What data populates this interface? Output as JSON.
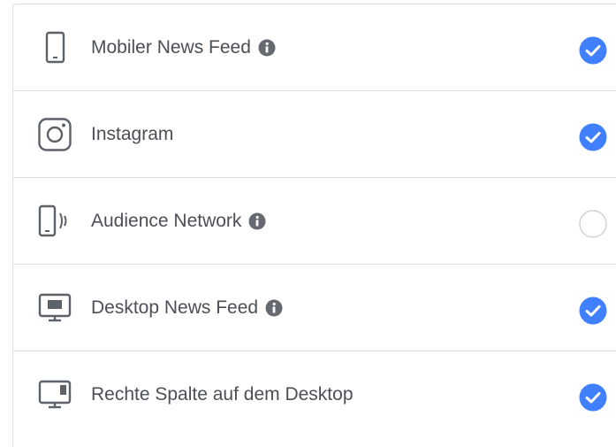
{
  "colors": {
    "accent": "#4080ff",
    "text": "#4b4f56",
    "icon": "#5d6168",
    "border": "#dddfe2"
  },
  "placements": [
    {
      "label": "Mobiler News Feed",
      "icon": "mobile-phone-icon",
      "has_info": true,
      "checked": true
    },
    {
      "label": "Instagram",
      "icon": "instagram-icon",
      "has_info": false,
      "checked": true
    },
    {
      "label": "Audience Network",
      "icon": "audience-network-icon",
      "has_info": true,
      "checked": false
    },
    {
      "label": "Desktop News Feed",
      "icon": "desktop-monitor-icon",
      "has_info": true,
      "checked": true
    },
    {
      "label": "Rechte Spalte auf dem Desktop",
      "icon": "desktop-right-column-icon",
      "has_info": false,
      "checked": true
    }
  ]
}
